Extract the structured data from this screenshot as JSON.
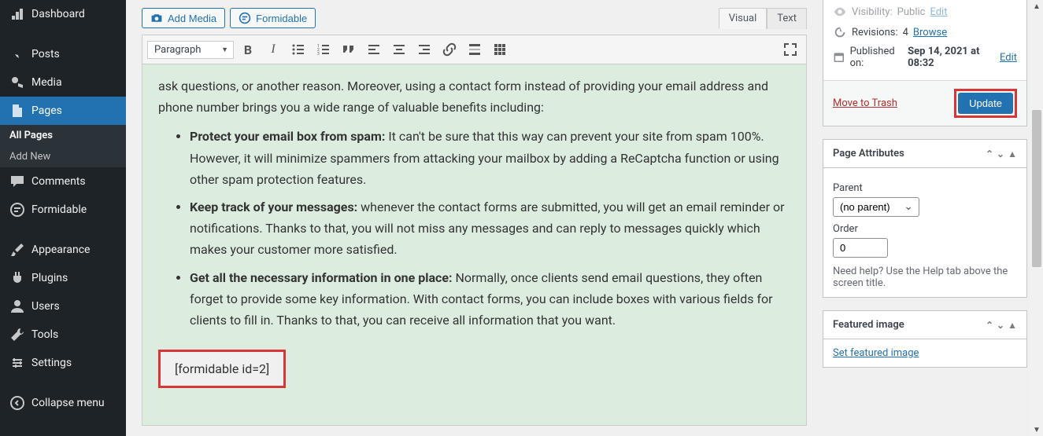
{
  "sidebar": {
    "items": [
      {
        "label": "Dashboard",
        "icon": "dashboard"
      },
      {
        "label": "Posts",
        "icon": "pin"
      },
      {
        "label": "Media",
        "icon": "media"
      },
      {
        "label": "Pages",
        "icon": "page",
        "active": true
      },
      {
        "label": "Comments",
        "icon": "comment"
      },
      {
        "label": "Formidable",
        "icon": "formidable"
      },
      {
        "label": "Appearance",
        "icon": "brush"
      },
      {
        "label": "Plugins",
        "icon": "plugin"
      },
      {
        "label": "Users",
        "icon": "users"
      },
      {
        "label": "Tools",
        "icon": "tools"
      },
      {
        "label": "Settings",
        "icon": "settings"
      },
      {
        "label": "Collapse menu",
        "icon": "collapse"
      }
    ],
    "pages_sub": [
      {
        "label": "All Pages",
        "current": true
      },
      {
        "label": "Add New",
        "current": false
      }
    ]
  },
  "editor": {
    "add_media_label": "Add Media",
    "formidable_btn_label": "Formidable",
    "tabs": {
      "visual": "Visual",
      "text": "Text"
    },
    "format_select": "Paragraph",
    "content": {
      "intro": "ask questions, or another reason. Moreover, using a contact form instead of providing your email address and phone number brings you a wide range of valuable benefits including:",
      "bullets": [
        {
          "bold": "Protect your email box from spam:",
          "rest": " It can't be sure that this way can prevent your site from spam 100%. However, it will minimize spammers from attacking your mailbox by adding a ReCaptcha function or using other spam protection features."
        },
        {
          "bold": "Keep track of your messages:",
          "rest": " whenever the contact forms are submitted, you will get an email reminder or notifications. Thanks to that, you will not miss any messages and can reply to messages quickly which makes your customer more satisfied."
        },
        {
          "bold": "Get all the necessary information in one place:",
          "rest": " Normally, once clients send email questions, they often forget to provide some key information. With contact forms, you can include boxes with various fields for clients to fill in. Thanks to that, you can receive all information that you want."
        }
      ],
      "shortcode": "[formidable id=2]"
    }
  },
  "publish": {
    "visibility_label": "Visibility:",
    "visibility_value": "Public",
    "visibility_edit": "Edit",
    "revisions_label": "Revisions:",
    "revisions_count": "4",
    "revisions_browse": "Browse",
    "published_label": "Published on:",
    "published_value": "Sep 14, 2021 at 08:32",
    "published_edit": "Edit",
    "trash": "Move to Trash",
    "update": "Update"
  },
  "page_attributes": {
    "title": "Page Attributes",
    "parent_label": "Parent",
    "parent_value": "(no parent)",
    "order_label": "Order",
    "order_value": "0",
    "help_text": "Need help? Use the Help tab above the screen title."
  },
  "featured_image": {
    "title": "Featured image",
    "set_link": "Set featured image"
  }
}
